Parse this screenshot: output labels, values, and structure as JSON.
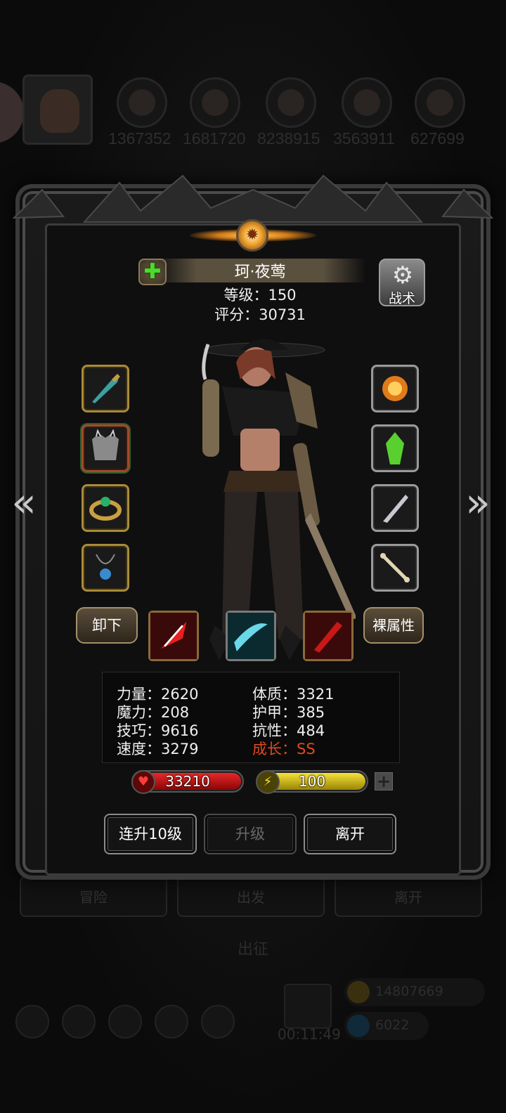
{
  "background": {
    "resource_numbers": [
      "1367352",
      "1681720",
      "8238915",
      "3563911",
      "627699"
    ],
    "tabs": [
      "冒险",
      "出发",
      "离开"
    ],
    "bottom_title": "出征",
    "timer": "00:11:49",
    "gold": "14807669",
    "gems": "6022"
  },
  "character": {
    "name": "珂·夜莺",
    "level_text": "等级：150",
    "score_text": "评分：30731"
  },
  "header": {
    "tactics_label": "战术"
  },
  "equipment": {
    "left": [
      "dagger-icon",
      "spiked-armor-icon",
      "ring-icon",
      "amulet-icon"
    ],
    "right": [
      "fire-relic-icon",
      "green-crystal-icon",
      "throwing-knife-icon",
      "bone-icon"
    ]
  },
  "actions": {
    "unequip_label": "卸下",
    "bare_stats_label": "裸属性"
  },
  "stats": {
    "strength": "力量：2620",
    "magic": "魔力：208",
    "skill": "技巧：9616",
    "speed": "速度：3279",
    "constitution": "体质：3321",
    "armor": "护甲：385",
    "resistance": "抗性：484",
    "growth": "成长：SS"
  },
  "bars": {
    "hp": "33210",
    "energy": "100",
    "hp_color": "#c81010",
    "energy_color": "#e0c81a"
  },
  "buttons": {
    "level_up_10": "连升10级",
    "level_up": "升级",
    "leave": "离开"
  }
}
